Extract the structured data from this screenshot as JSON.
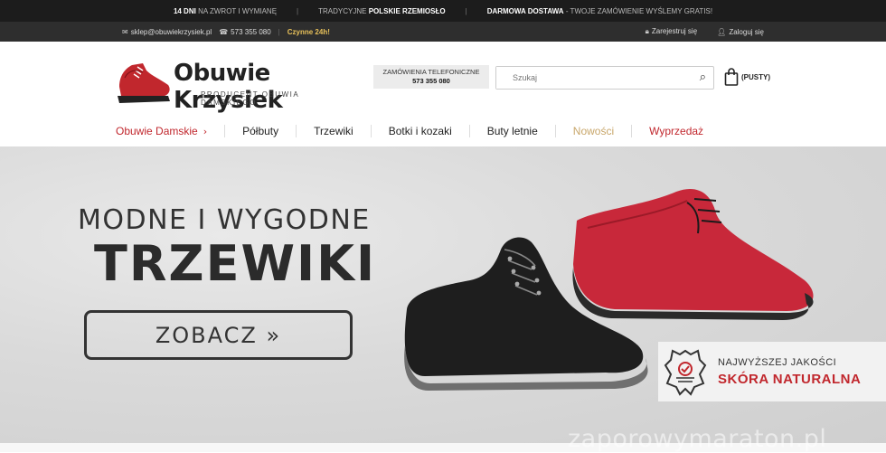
{
  "topbar": {
    "seg1_bold": "14 DNI",
    "seg1_rest": "NA ZWROT I WYMIANĘ",
    "seg2_pre": "TRADYCYJNE",
    "seg2_bold": "POLSKIE RZEMIOSŁO",
    "seg3_bold": "DARMOWA DOSTAWA",
    "seg3_rest": "- TWOJE ZAMÓWIENIE WYŚLEMY GRATIS!",
    "separator": "|"
  },
  "infobar": {
    "email": "sklep@obuwiekrzysiek.pl",
    "phone": "573 355 080",
    "hours": "Czynne 24h!",
    "register": "Zarejestruj się",
    "login": "Zaloguj się"
  },
  "header": {
    "logo_text": "Obuwie Krzysiek",
    "logo_sub": "PRODUCENT OBUWIA DAMSKIEGO",
    "phone_label": "ZAMÓWIENIA TELEFONICZNE",
    "phone_number": "573 355 080",
    "search_placeholder": "Szukaj",
    "cart_label": "(PUSTY)"
  },
  "nav": {
    "items": [
      "Obuwie Damskie",
      "Półbuty",
      "Trzewiki",
      "Botki i kozaki",
      "Buty letnie",
      "Nowości",
      "Wyprzedaż"
    ]
  },
  "hero": {
    "line1": "MODNE I WYGODNE",
    "line2": "TRZEWIKI",
    "cta": "ZOBACZ »",
    "badge_line1": "NAJWYŻSZEJ JAKOŚCI",
    "badge_line2": "SKÓRA NATURALNA"
  },
  "watermark": "zaporowymaraton.pl",
  "colors": {
    "accent": "#c1272d",
    "gold": "#c8a66a",
    "topbar": "#1c1c1c"
  }
}
